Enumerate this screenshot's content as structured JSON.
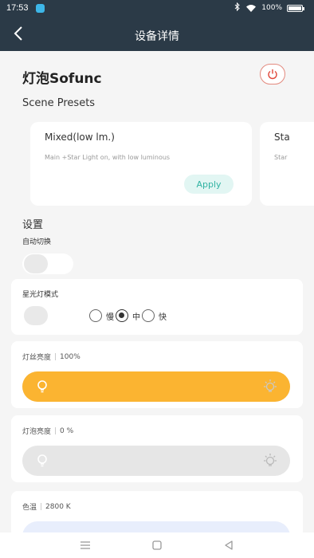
{
  "status_bar": {
    "time": "17:53",
    "battery_text": "100%",
    "battery_level": 1.0
  },
  "app_bar": {
    "title": "设备详情",
    "back_icon": "chevron-left-icon"
  },
  "device": {
    "name": "灯泡Sofunc",
    "power_icon": "power-icon",
    "power_color": "#e0483b"
  },
  "scene_presets": {
    "title": "Scene Presets",
    "items": [
      {
        "title": "Mixed(low lm.)",
        "description": "Main +Star Light on, with low luminous",
        "button_label": "Apply"
      },
      {
        "title": "Sta",
        "description": "Star"
      }
    ]
  },
  "settings": {
    "title": "设置",
    "auto_switch": {
      "label": "自动切换",
      "on": false
    },
    "star_mode": {
      "label": "星光灯模式",
      "on": false,
      "speeds": [
        {
          "label": "慢",
          "selected": false
        },
        {
          "label": "中",
          "selected": true
        },
        {
          "label": "快",
          "selected": false
        }
      ]
    },
    "filament_brightness": {
      "label": "灯丝亮度",
      "value_text": "100%",
      "level": 1.0,
      "color": "#fbb431"
    },
    "bulb_brightness": {
      "label": "灯泡亮度",
      "value_text": "0 %",
      "level": 0.0,
      "color": "#e6e6e6"
    },
    "color_temp": {
      "label": "色温",
      "value_text": "2800 K"
    }
  },
  "nav_bar": {
    "icons": [
      "menu-icon",
      "home-square-icon",
      "back-triangle-icon"
    ]
  }
}
